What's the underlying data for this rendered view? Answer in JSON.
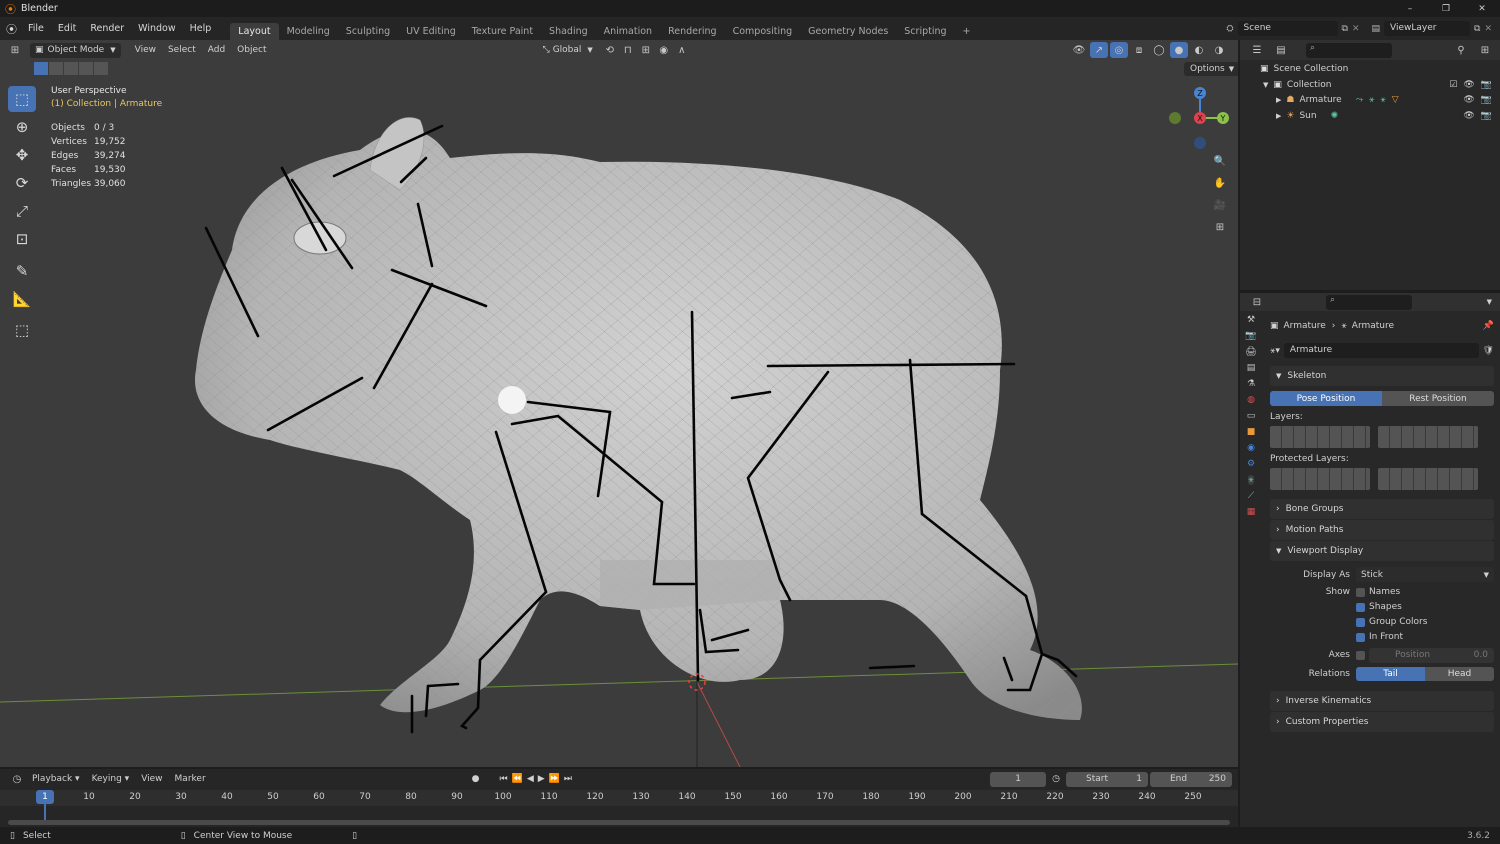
{
  "app": {
    "title": "Blender",
    "version": "3.6.2"
  },
  "window_controls": {
    "minimize": "–",
    "maximize": "❐",
    "close": "✕"
  },
  "menu": [
    "File",
    "Edit",
    "Render",
    "Window",
    "Help"
  ],
  "workspaces": [
    "Layout",
    "Modeling",
    "Sculpting",
    "UV Editing",
    "Texture Paint",
    "Shading",
    "Animation",
    "Rendering",
    "Compositing",
    "Geometry Nodes",
    "Scripting"
  ],
  "active_workspace": "Layout",
  "scene": {
    "name": "Scene",
    "view_layer": "ViewLayer"
  },
  "viewport": {
    "mode": "Object Mode",
    "menus": [
      "View",
      "Select",
      "Add",
      "Object"
    ],
    "transform": "Global",
    "options_label": "Options",
    "perspective": "User Perspective",
    "collection_line": "(1) Collection | Armature",
    "stats": [
      {
        "label": "Objects",
        "value": "0 / 3"
      },
      {
        "label": "Vertices",
        "value": "19,752"
      },
      {
        "label": "Edges",
        "value": "39,274"
      },
      {
        "label": "Faces",
        "value": "19,530"
      },
      {
        "label": "Triangles",
        "value": "39,060"
      }
    ],
    "gizmo": {
      "z": "Z",
      "x": "X",
      "y": "Y"
    }
  },
  "outliner": {
    "root": "Scene Collection",
    "collection": "Collection",
    "items": [
      "Armature",
      "Sun"
    ]
  },
  "properties": {
    "breadcrumb": [
      "Armature",
      "Armature"
    ],
    "data_name": "Armature",
    "skeleton": {
      "title": "Skeleton",
      "pose_position": "Pose Position",
      "rest_position": "Rest Position",
      "layers_label": "Layers:",
      "protected_label": "Protected Layers:"
    },
    "collapsed_panels": [
      "Bone Groups",
      "Motion Paths"
    ],
    "viewport_display": {
      "title": "Viewport Display",
      "display_as_label": "Display As",
      "display_as_value": "Stick",
      "show_label": "Show",
      "show_options": [
        {
          "label": "Names",
          "checked": false
        },
        {
          "label": "Shapes",
          "checked": true
        },
        {
          "label": "Group Colors",
          "checked": true
        },
        {
          "label": "In Front",
          "checked": true
        }
      ],
      "axes_label": "Axes",
      "axes_position_label": "Position",
      "axes_position_value": "0.0",
      "relations_label": "Relations",
      "tail": "Tail",
      "head": "Head"
    },
    "bottom_panels": [
      "Inverse Kinematics",
      "Custom Properties"
    ]
  },
  "timeline": {
    "menus": [
      "Playback",
      "Keying",
      "View",
      "Marker"
    ],
    "current_frame": "1",
    "start_label": "Start",
    "start_value": "1",
    "end_label": "End",
    "end_value": "250",
    "ruler": [
      "1",
      "10",
      "20",
      "30",
      "40",
      "50",
      "60",
      "70",
      "80",
      "90",
      "100",
      "110",
      "120",
      "130",
      "140",
      "150",
      "160",
      "170",
      "180",
      "190",
      "200",
      "210",
      "220",
      "230",
      "240",
      "250"
    ]
  },
  "statusbar": {
    "left": "Select",
    "middle": "Center View to Mouse"
  },
  "colors": {
    "accent": "#4772b3",
    "viewport_bg": "#3c3c3c",
    "panel_bg": "#282828",
    "x_axis": "#e0414f",
    "y_axis": "#8bc34a",
    "z_axis": "#4784d4"
  }
}
